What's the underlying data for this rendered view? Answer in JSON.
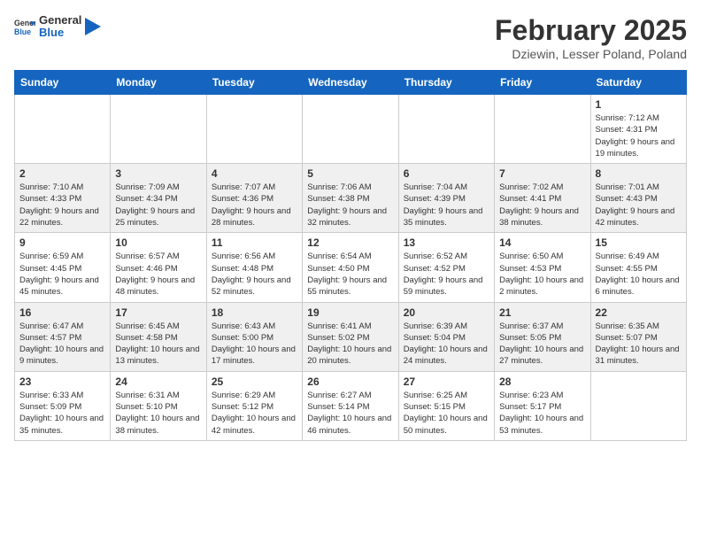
{
  "header": {
    "logo_general": "General",
    "logo_blue": "Blue",
    "month": "February 2025",
    "location": "Dziewin, Lesser Poland, Poland"
  },
  "weekdays": [
    "Sunday",
    "Monday",
    "Tuesday",
    "Wednesday",
    "Thursday",
    "Friday",
    "Saturday"
  ],
  "weeks": [
    [
      {
        "day": "",
        "info": ""
      },
      {
        "day": "",
        "info": ""
      },
      {
        "day": "",
        "info": ""
      },
      {
        "day": "",
        "info": ""
      },
      {
        "day": "",
        "info": ""
      },
      {
        "day": "",
        "info": ""
      },
      {
        "day": "1",
        "info": "Sunrise: 7:12 AM\nSunset: 4:31 PM\nDaylight: 9 hours and 19 minutes."
      }
    ],
    [
      {
        "day": "2",
        "info": "Sunrise: 7:10 AM\nSunset: 4:33 PM\nDaylight: 9 hours and 22 minutes."
      },
      {
        "day": "3",
        "info": "Sunrise: 7:09 AM\nSunset: 4:34 PM\nDaylight: 9 hours and 25 minutes."
      },
      {
        "day": "4",
        "info": "Sunrise: 7:07 AM\nSunset: 4:36 PM\nDaylight: 9 hours and 28 minutes."
      },
      {
        "day": "5",
        "info": "Sunrise: 7:06 AM\nSunset: 4:38 PM\nDaylight: 9 hours and 32 minutes."
      },
      {
        "day": "6",
        "info": "Sunrise: 7:04 AM\nSunset: 4:39 PM\nDaylight: 9 hours and 35 minutes."
      },
      {
        "day": "7",
        "info": "Sunrise: 7:02 AM\nSunset: 4:41 PM\nDaylight: 9 hours and 38 minutes."
      },
      {
        "day": "8",
        "info": "Sunrise: 7:01 AM\nSunset: 4:43 PM\nDaylight: 9 hours and 42 minutes."
      }
    ],
    [
      {
        "day": "9",
        "info": "Sunrise: 6:59 AM\nSunset: 4:45 PM\nDaylight: 9 hours and 45 minutes."
      },
      {
        "day": "10",
        "info": "Sunrise: 6:57 AM\nSunset: 4:46 PM\nDaylight: 9 hours and 48 minutes."
      },
      {
        "day": "11",
        "info": "Sunrise: 6:56 AM\nSunset: 4:48 PM\nDaylight: 9 hours and 52 minutes."
      },
      {
        "day": "12",
        "info": "Sunrise: 6:54 AM\nSunset: 4:50 PM\nDaylight: 9 hours and 55 minutes."
      },
      {
        "day": "13",
        "info": "Sunrise: 6:52 AM\nSunset: 4:52 PM\nDaylight: 9 hours and 59 minutes."
      },
      {
        "day": "14",
        "info": "Sunrise: 6:50 AM\nSunset: 4:53 PM\nDaylight: 10 hours and 2 minutes."
      },
      {
        "day": "15",
        "info": "Sunrise: 6:49 AM\nSunset: 4:55 PM\nDaylight: 10 hours and 6 minutes."
      }
    ],
    [
      {
        "day": "16",
        "info": "Sunrise: 6:47 AM\nSunset: 4:57 PM\nDaylight: 10 hours and 9 minutes."
      },
      {
        "day": "17",
        "info": "Sunrise: 6:45 AM\nSunset: 4:58 PM\nDaylight: 10 hours and 13 minutes."
      },
      {
        "day": "18",
        "info": "Sunrise: 6:43 AM\nSunset: 5:00 PM\nDaylight: 10 hours and 17 minutes."
      },
      {
        "day": "19",
        "info": "Sunrise: 6:41 AM\nSunset: 5:02 PM\nDaylight: 10 hours and 20 minutes."
      },
      {
        "day": "20",
        "info": "Sunrise: 6:39 AM\nSunset: 5:04 PM\nDaylight: 10 hours and 24 minutes."
      },
      {
        "day": "21",
        "info": "Sunrise: 6:37 AM\nSunset: 5:05 PM\nDaylight: 10 hours and 27 minutes."
      },
      {
        "day": "22",
        "info": "Sunrise: 6:35 AM\nSunset: 5:07 PM\nDaylight: 10 hours and 31 minutes."
      }
    ],
    [
      {
        "day": "23",
        "info": "Sunrise: 6:33 AM\nSunset: 5:09 PM\nDaylight: 10 hours and 35 minutes."
      },
      {
        "day": "24",
        "info": "Sunrise: 6:31 AM\nSunset: 5:10 PM\nDaylight: 10 hours and 38 minutes."
      },
      {
        "day": "25",
        "info": "Sunrise: 6:29 AM\nSunset: 5:12 PM\nDaylight: 10 hours and 42 minutes."
      },
      {
        "day": "26",
        "info": "Sunrise: 6:27 AM\nSunset: 5:14 PM\nDaylight: 10 hours and 46 minutes."
      },
      {
        "day": "27",
        "info": "Sunrise: 6:25 AM\nSunset: 5:15 PM\nDaylight: 10 hours and 50 minutes."
      },
      {
        "day": "28",
        "info": "Sunrise: 6:23 AM\nSunset: 5:17 PM\nDaylight: 10 hours and 53 minutes."
      },
      {
        "day": "",
        "info": ""
      }
    ]
  ]
}
